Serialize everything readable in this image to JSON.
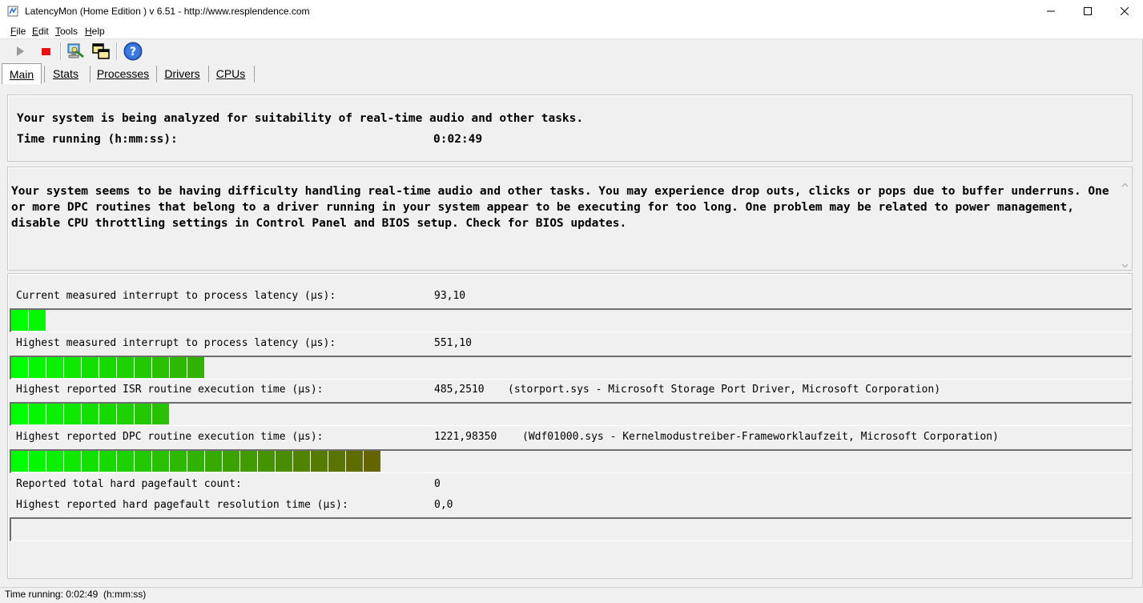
{
  "window": {
    "title": "LatencyMon  (Home Edition )  v 6.51 - http://www.resplendence.com",
    "app_icon": "latencymon-icon",
    "controls": {
      "minimize": "minimize-icon",
      "maximize": "maximize-icon",
      "close": "close-icon"
    }
  },
  "menu": {
    "items": [
      {
        "hotkey": "F",
        "rest": "ile"
      },
      {
        "hotkey": "E",
        "rest": "dit"
      },
      {
        "hotkey": "T",
        "rest": "ools"
      },
      {
        "hotkey": "H",
        "rest": "elp"
      }
    ]
  },
  "toolbar": {
    "buttons": [
      {
        "icon": "play-icon",
        "enabled": false
      },
      {
        "icon": "stop-icon",
        "enabled": true
      },
      {
        "icon": "computer-search-icon",
        "enabled": true
      },
      {
        "icon": "windows-icon",
        "enabled": true
      },
      {
        "icon": "help-icon",
        "enabled": true
      }
    ]
  },
  "tabs": [
    {
      "label": "Main",
      "active": true
    },
    {
      "label": "Stats",
      "active": false
    },
    {
      "label": "Processes",
      "active": false
    },
    {
      "label": "Drivers",
      "active": false
    },
    {
      "label": "CPUs",
      "active": false
    }
  ],
  "status": {
    "heading": "Your system is being analyzed for suitability of real-time audio and other tasks.",
    "time_running_label": "Time running (h:mm:ss):",
    "time_running_value": "0:02:49"
  },
  "message": "Your system seems to be having difficulty handling real-time audio and other tasks. You may experience drop outs, clicks or pops due to buffer underruns. One or more DPC routines that belong to a driver running in your system appear to be executing for too long. One problem may be related to power management, disable CPU throttling settings in Control Panel and BIOS setup. Check for BIOS updates.",
  "metrics": {
    "current_latency": {
      "label": "Current measured interrupt to process latency (µs):",
      "value": "93,10",
      "bar_segments": 2
    },
    "highest_latency": {
      "label": "Highest measured interrupt to process latency (µs):",
      "value": "551,10",
      "bar_segments": 11
    },
    "isr": {
      "label": "Highest reported ISR routine execution time (µs):",
      "value": "485,2510",
      "driver": "(storport.sys - Microsoft Storage Port Driver, Microsoft Corporation)",
      "bar_segments": 9
    },
    "dpc": {
      "label": "Highest reported DPC routine execution time (µs):",
      "value": "1221,98350",
      "driver": "(Wdf01000.sys - Kernelmodustreiber-Frameworklaufzeit, Microsoft Corporation)",
      "bar_segments": 21
    },
    "pagefault_count": {
      "label": "Reported total hard pagefault count:",
      "value": "0"
    },
    "pagefault_time": {
      "label": "Highest reported hard pagefault resolution time (µs):",
      "value": "0,0",
      "bar_segments": 0
    }
  },
  "statusbar": {
    "text": "Time running: 0:02:49  (h:mm:ss)"
  }
}
